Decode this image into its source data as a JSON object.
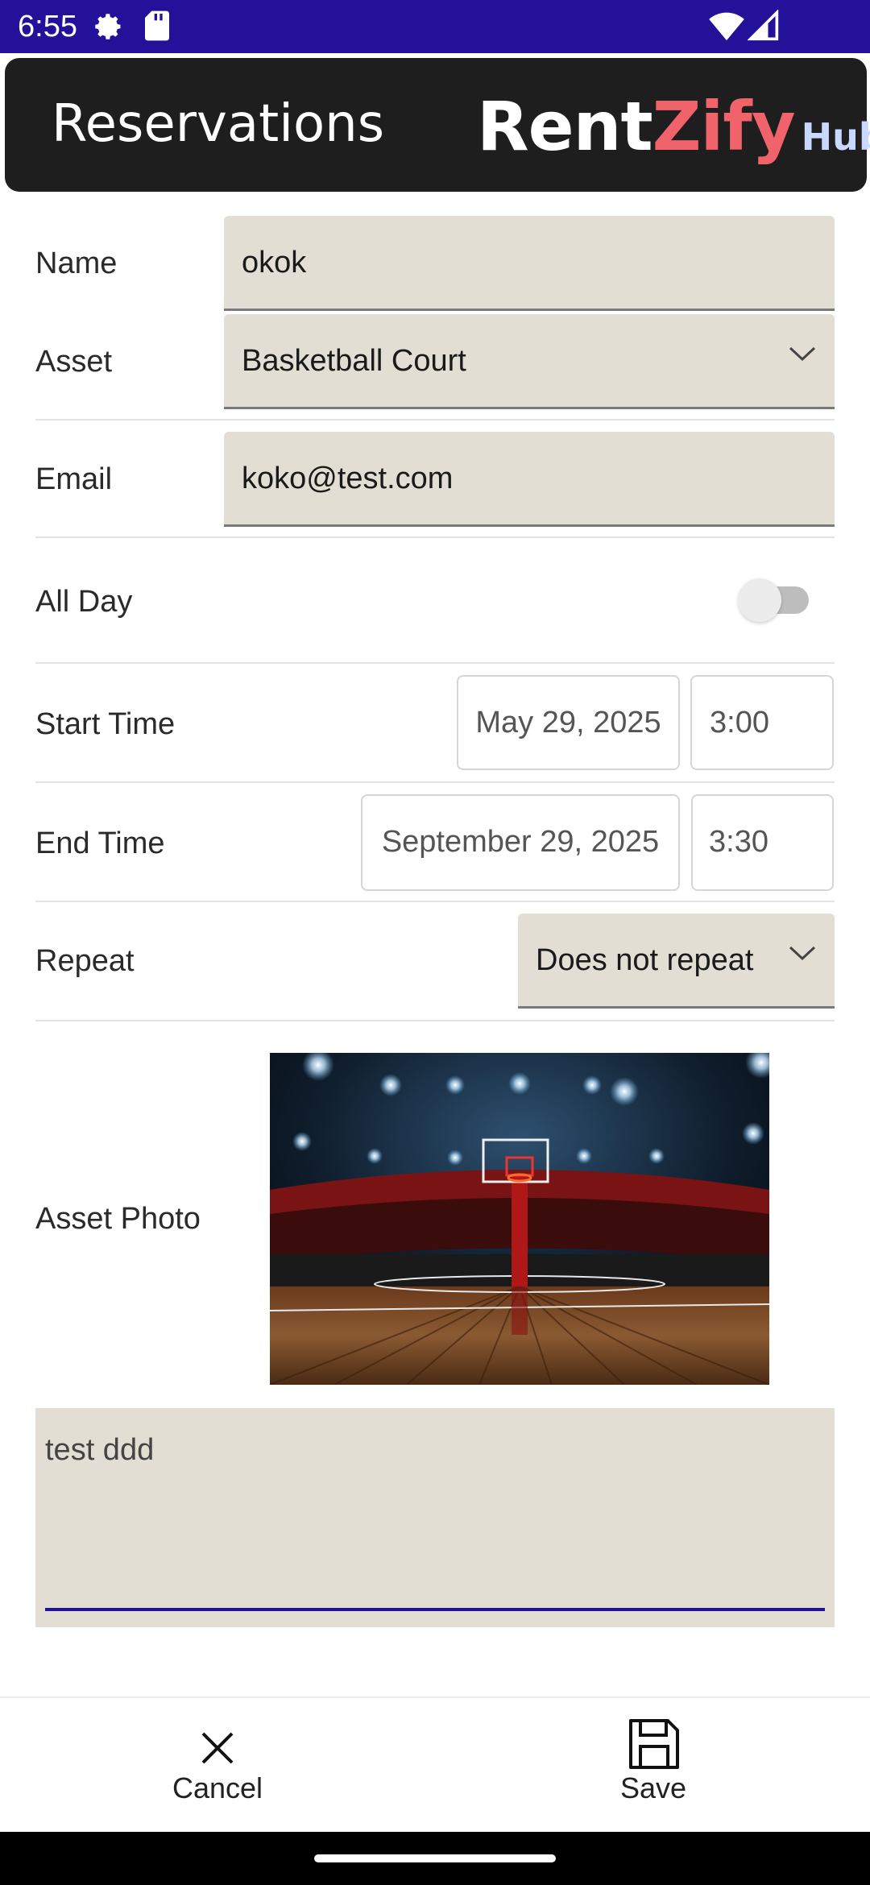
{
  "status_bar": {
    "time": "6:55",
    "icons": [
      "settings-gear-icon",
      "sd-card-icon",
      "wifi-icon",
      "cell-signal-icon"
    ]
  },
  "header": {
    "title": "Reservations",
    "logo_part1": "Rent",
    "logo_part2": "Zify",
    "logo_part3": "Hub",
    "logo_colors": {
      "rent": "#ffffff",
      "zify": "#f0636b",
      "hub": "#c9d8ff"
    }
  },
  "form": {
    "name": {
      "label": "Name",
      "value": "okok"
    },
    "asset": {
      "label": "Asset",
      "value": "Basketball Court"
    },
    "email": {
      "label": "Email",
      "value": "koko@test.com"
    },
    "all_day": {
      "label": "All Day",
      "on": false
    },
    "start_time": {
      "label": "Start Time",
      "date": "May 29, 2025",
      "time": "3:00"
    },
    "end_time": {
      "label": "End Time",
      "date": "September 29, 2025",
      "time": "3:30"
    },
    "repeat": {
      "label": "Repeat",
      "value": "Does not repeat"
    },
    "asset_photo": {
      "label": "Asset Photo"
    },
    "notes": {
      "value": "test ddd"
    }
  },
  "actions": {
    "cancel_label": "Cancel",
    "save_label": "Save"
  },
  "colors": {
    "status_bar": "#23119a",
    "header_bg": "#1e1e1e",
    "field_bg": "#e2ded3",
    "accent": "#23119a"
  }
}
